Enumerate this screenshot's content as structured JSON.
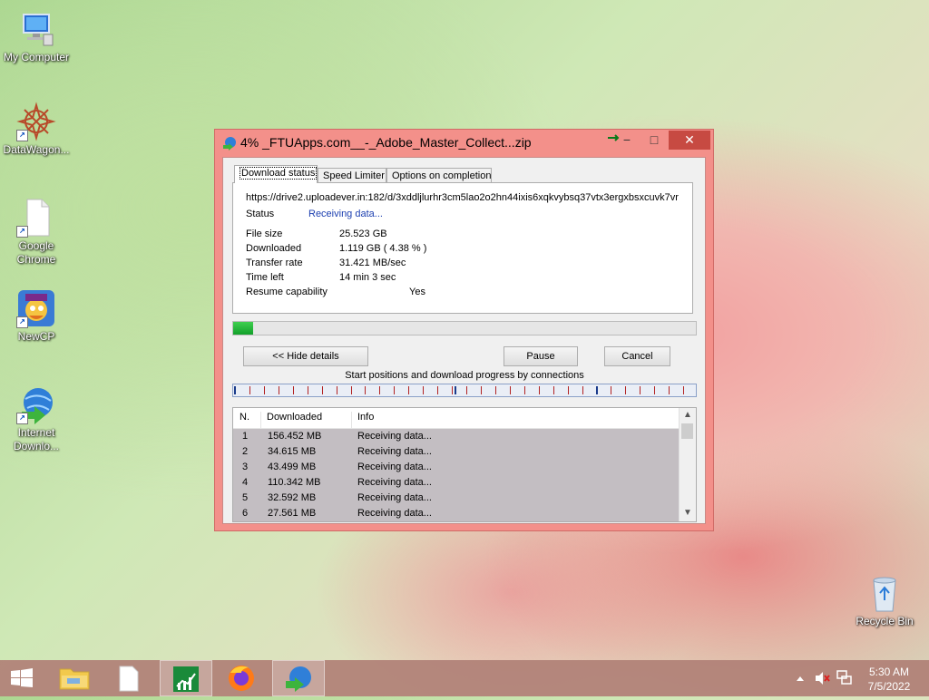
{
  "desktop": {
    "icons": [
      {
        "label": "My Computer"
      },
      {
        "label": "DataWagon..."
      },
      {
        "label": "Google Chrome"
      },
      {
        "label": "NewCP"
      },
      {
        "label": "Internet Downlo..."
      },
      {
        "label": "Recycle Bin"
      }
    ]
  },
  "window": {
    "title": "4% _FTUApps.com__-_Adobe_Master_Collect...zip",
    "close_glyph": "✕",
    "minimize_glyph": "−",
    "maximize_glyph": "□",
    "tabs": [
      "Download status",
      "Speed Limiter",
      "Options on completion"
    ],
    "url": "https://drive2.uploadever.in:182/d/3xddljlurhr3cm5lao2o2hn44ixis6xqkvybsq37vtx3ergxbsxcuvk7vr",
    "status_label": "Status",
    "status_value": "Receiving data...",
    "details": [
      {
        "key": "File size",
        "value": "25.523  GB"
      },
      {
        "key": "Downloaded",
        "value": "1.119  GB  ( 4.38 % )"
      },
      {
        "key": "Transfer rate",
        "value": "31.421  MB/sec"
      },
      {
        "key": "Time left",
        "value": "14 min 3 sec"
      },
      {
        "key": "Resume capability",
        "value": "Yes"
      }
    ],
    "progress_percent": 4.38,
    "buttons": {
      "hide_details": "<< Hide details",
      "pause": "Pause",
      "cancel": "Cancel"
    },
    "connections_label": "Start positions and download progress by connections",
    "list_headers": {
      "n": "N.",
      "downloaded": "Downloaded",
      "info": "Info"
    },
    "connections": [
      {
        "n": "1",
        "downloaded": "156.452  MB",
        "info": "Receiving data..."
      },
      {
        "n": "2",
        "downloaded": "34.615  MB",
        "info": "Receiving data..."
      },
      {
        "n": "3",
        "downloaded": "43.499  MB",
        "info": "Receiving data..."
      },
      {
        "n": "4",
        "downloaded": "110.342  MB",
        "info": "Receiving data..."
      },
      {
        "n": "5",
        "downloaded": "32.592  MB",
        "info": "Receiving data..."
      },
      {
        "n": "6",
        "downloaded": "27.561  MB",
        "info": "Receiving data..."
      }
    ]
  },
  "taskbar": {
    "time": "5:30 AM",
    "date": "7/5/2022"
  },
  "colors": {
    "progress": "#1db536",
    "title_bar": "#f3908a",
    "close": "#c74a42"
  }
}
